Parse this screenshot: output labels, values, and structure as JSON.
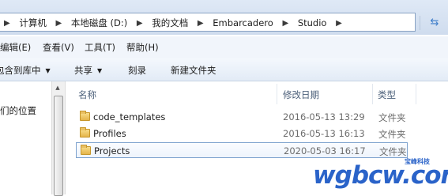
{
  "address_bar": {
    "crumbs": [
      "计算机",
      "本地磁盘 (D:)",
      "我的文档",
      "Embarcadero",
      "Studio"
    ],
    "separator_icon": "chevron-right",
    "refresh_icon": "refresh"
  },
  "menubar": {
    "items": [
      "编辑(E)",
      "查看(V)",
      "工具(T)",
      "帮助(H)"
    ]
  },
  "commandbar": {
    "include_in_library": "包含到库中",
    "share": "共享",
    "burn": "刻录",
    "new_folder": "新建文件夹"
  },
  "nav_pane": {
    "item": "们的位置"
  },
  "file_list": {
    "columns": [
      "名称",
      "修改日期",
      "类型"
    ],
    "rows": [
      {
        "name": "code_templates",
        "modified": "2016-05-13 13:29",
        "type": "文件夹",
        "selected": false
      },
      {
        "name": "Profiles",
        "modified": "2016-05-13 16:13",
        "type": "文件夹",
        "selected": false
      },
      {
        "name": "Projects",
        "modified": "2020-05-03 16:17",
        "type": "文件夹",
        "selected": true
      }
    ]
  },
  "watermark": {
    "text": "wgbcw.com",
    "subtext": "宝峰科技"
  },
  "colors": {
    "accent": "#3c7cc9",
    "selection_border": "#7da2ce",
    "watermark": "#2a63c9"
  }
}
